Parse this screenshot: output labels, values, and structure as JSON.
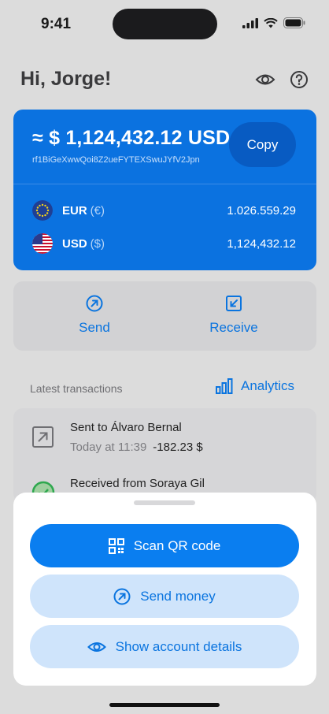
{
  "status_bar": {
    "time": "9:41"
  },
  "header": {
    "greeting": "Hi, Jorge!",
    "icons": [
      "eye-icon",
      "help-icon"
    ]
  },
  "balance": {
    "total": "≈ $ 1,124,432.12 USD",
    "address": "rf1BiGeXwwQoi8Z2ueFYTEXSwuJYfV2Jpn",
    "copy_label": "Copy",
    "currencies": [
      {
        "code": "EUR",
        "symbol": "(€)",
        "value": "1.026.559.29",
        "flag": "eu-flag-icon"
      },
      {
        "code": "USD",
        "symbol": "($)",
        "value": "1,124,432.12",
        "flag": "us-flag-icon"
      }
    ]
  },
  "actions": {
    "send_label": "Send",
    "receive_label": "Receive"
  },
  "transactions": {
    "title": "Latest transactions",
    "analytics_label": "Analytics",
    "items": [
      {
        "title": "Sent to Álvaro Bernal",
        "date": "Today at 11:39",
        "amount": "-182.23 $"
      },
      {
        "title": "Received from Soraya Gil"
      }
    ]
  },
  "sheet": {
    "scan_label": "Scan QR code",
    "send_money_label": "Send money",
    "account_details_label": "Show account details"
  },
  "colors": {
    "accent": "#0a7ef0",
    "card": "#0b72e0",
    "secondary_button": "#cfe4fb"
  }
}
